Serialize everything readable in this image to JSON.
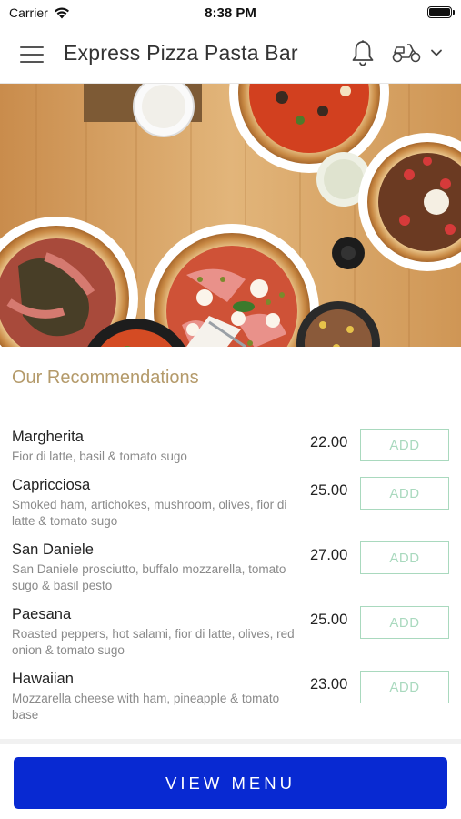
{
  "status_bar": {
    "carrier": "Carrier",
    "time": "8:38 PM"
  },
  "header": {
    "title": "Express Pizza Pasta Bar",
    "icons": [
      "menu-icon",
      "bell-icon",
      "scooter-icon",
      "chevron-down-icon"
    ]
  },
  "hero": {
    "image": "pizza-table-photo"
  },
  "recommendations": {
    "title": "Our Recommendations",
    "items": [
      {
        "name": "Margherita",
        "description": "Fior di latte, basil & tomato sugo",
        "price": "22.00",
        "add_label": "ADD"
      },
      {
        "name": "Capricciosa",
        "description": "Smoked ham, artichokes, mushroom, olives, fior di latte & tomato sugo",
        "price": "25.00",
        "add_label": "ADD"
      },
      {
        "name": "San Daniele",
        "description": "San Daniele prosciutto, buffalo mozzarella, tomato sugo & basil pesto",
        "price": "27.00",
        "add_label": "ADD"
      },
      {
        "name": "Paesana",
        "description": "Roasted peppers, hot salami, fior di latte, olives, red onion & tomato sugo",
        "price": "25.00",
        "add_label": "ADD"
      },
      {
        "name": "Hawaiian",
        "description": "Mozzarella cheese with ham, pineapple & tomato base",
        "price": "23.00",
        "add_label": "ADD"
      }
    ]
  },
  "footer": {
    "view_menu_label": "VIEW MENU"
  },
  "colors": {
    "primary": "#0829d2",
    "accent_gold": "#b49a6a",
    "add_green": "#a9d9be"
  }
}
